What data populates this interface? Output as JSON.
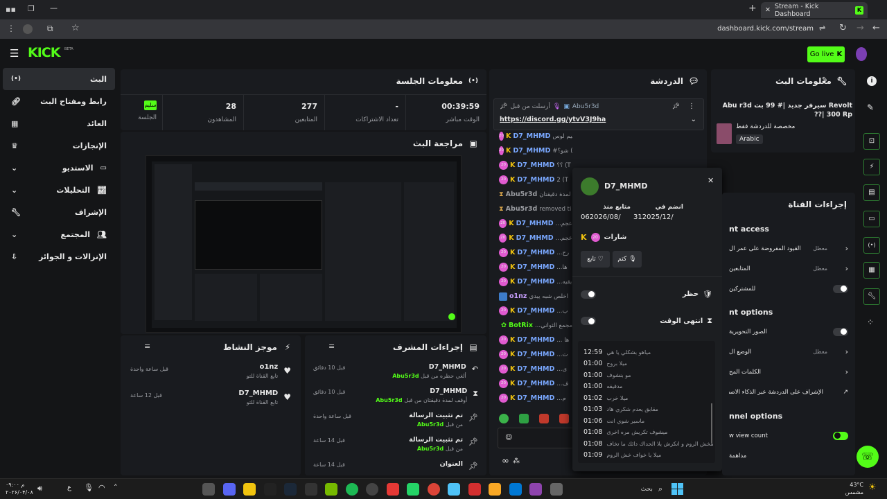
{
  "browser": {
    "tab_title": "Stream - Kick Dashboard",
    "url": "dashboard.kick.com/stream",
    "new_tab": "+"
  },
  "topbar": {
    "logo": "KICK",
    "logo_sup": "BETA",
    "go_live": "Go live"
  },
  "sidebar": {
    "items": [
      {
        "label": "البث",
        "icon": "broadcast-icon"
      },
      {
        "label": "رابط ومفتاح البث",
        "icon": "link-icon"
      },
      {
        "label": "العائد",
        "icon": "chart-icon"
      },
      {
        "label": "الإنجازات",
        "icon": "trophy-icon"
      },
      {
        "label": "الاستديو",
        "icon": "studio-icon"
      },
      {
        "label": "التحليلات",
        "icon": "analytics-icon"
      },
      {
        "label": "الإشراف",
        "icon": "wrench-icon"
      },
      {
        "label": "المجتمع",
        "icon": "community-icon"
      },
      {
        "label": "الإنزالات و الجوائز",
        "icon": "drops-icon"
      }
    ]
  },
  "session": {
    "title": "معلومات الجلسة",
    "status": "سليم",
    "status_label": "الجلسة",
    "stats": [
      {
        "value": "28",
        "label": "المشاهدون"
      },
      {
        "value": "277",
        "label": "المتابعين"
      },
      {
        "value": "-",
        "label": "تعداد الاشتراكات"
      },
      {
        "value": "00:39:59",
        "label": "الوقت مباشر"
      }
    ]
  },
  "preview": {
    "title": "مراجعة البث"
  },
  "activity": {
    "title": "موجز النشاط",
    "items": [
      {
        "user": "o1nz",
        "desc": "تابع القناة للتو",
        "time": "قبل ساعة واحدة"
      },
      {
        "user": "D7_MHMD",
        "desc": "تابع القناة للتو",
        "time": "قبل 12 ساعة"
      }
    ]
  },
  "modactions": {
    "title": "إجراءات المشرف",
    "items": [
      {
        "user": "D7_MHMD",
        "desc": "ألغي حظره من قبل",
        "by": "Abu5r3d",
        "time": "قبل 10 دقائق",
        "icon": "undo-icon"
      },
      {
        "user": "D7_MHMD",
        "desc": "أوقف لمدة دقيقتان من قبل",
        "by": "Abu5r3d",
        "time": "قبل 10 دقائق",
        "icon": "hourglass-icon"
      },
      {
        "user": "تم تثبيت الرسالة",
        "desc": "من قبل",
        "by": "Abu5r3d",
        "time": "قبل ساعة واحدة",
        "icon": "pin-icon"
      },
      {
        "user": "تم تثبيت الرسالة",
        "desc": "من قبل",
        "by": "Abu5r3d",
        "time": "قبل 14 ساعة",
        "icon": "pin-icon"
      },
      {
        "user": "العنوان",
        "desc": "",
        "by": "",
        "time": "قبل 14 ساعة",
        "icon": "pin-icon"
      }
    ]
  },
  "chat": {
    "title": "الدردشة",
    "pinned_by": "أرسلت من قبل",
    "pinned_user": "Abu5r3d",
    "pinned_link": "https://discord.gg/ytvV3J9ha",
    "lines": [
      {
        "user": "D7_MHMD",
        "text": "ياهدولا عليم لوس (Timed out)"
      },
      {
        "user": "D7_MHMD",
        "text": "#شو؟ (Timed out)"
      },
      {
        "user": "D7_MHMD",
        "text": "؟؟ (T"
      },
      {
        "user": "D7_MHMD",
        "text": "2 (T"
      },
      {
        "user": "Abu5r3d",
        "text": "أوقف لمدة دقيقتان D7"
      },
      {
        "user": "Abu5r3d",
        "text": "removed ti"
      },
      {
        "user": "D7_MHMD",
        "text": "...عجم"
      },
      {
        "user": "D7_MHMD",
        "text": "...عجم"
      },
      {
        "user": "D7_MHMD",
        "text": "...رح"
      },
      {
        "user": "D7_MHMD",
        "text": "...ها"
      },
      {
        "user": "D7_MHMD",
        "text": "...يقيه"
      },
      {
        "user": "o1nz",
        "text": "اخلص شبه يبدي"
      },
      {
        "user": "D7_MHMD",
        "text": "...ب"
      },
      {
        "user": "BotRix",
        "text": "...مجمع الثواني"
      },
      {
        "user": "D7_MHMD",
        "text": "... ها"
      },
      {
        "user": "D7_MHMD",
        "text": "...ت"
      },
      {
        "user": "D7_MHMD",
        "text": "...ى"
      },
      {
        "user": "D7_MHMD",
        "text": "...ف"
      },
      {
        "user": "D7_MHMD",
        "text": "...م"
      }
    ]
  },
  "usercard": {
    "name": "D7_MHMD",
    "followed_label": "متابع منذ",
    "followed": "062026/08/",
    "joined_label": "انضم في",
    "joined": "312025/12/",
    "badges_label": "شارات",
    "unfollow": "تابع",
    "mute": "كتم",
    "ban_label": "حظر",
    "timeout_label": "انتهى الوقت",
    "history": [
      {
        "time": "12:59",
        "text": "مياهو بشكلي يا هي"
      },
      {
        "time": "01:00",
        "text": "ميلا بروح"
      },
      {
        "time": "01:00",
        "text": "مو بنشوف"
      },
      {
        "time": "01:00",
        "text": "مدقيقه"
      },
      {
        "time": "01:02",
        "text": "ميلا خرب"
      },
      {
        "time": "01:03",
        "text": "مقابق يعدم شكري هاد"
      },
      {
        "time": "01:06",
        "text": "ماسير شوي انت"
      },
      {
        "time": "01:08",
        "text": "ميشوف تكريش مره اخرى"
      },
      {
        "time": "01:08",
        "text": "مخش الروم و انكرش يلا الحداك دائك ما تخاف"
      },
      {
        "time": "01:09",
        "text": "ميلا يا خواف خش الروم"
      }
    ]
  },
  "streaminfo": {
    "title": "معلومات البث",
    "stream_title": "Revolt سيرفر جديد |# 99 بث Abu r3d ??| 300 Rp",
    "category": "مخصصة للدردشة فقط",
    "language": "Arabic"
  },
  "channelactions": {
    "title": "إجراءات القناة",
    "section1": "nt access",
    "rows1": [
      {
        "label": "القيود المفروضة على عمر ال",
        "value": "معطل",
        "kind": "chev"
      },
      {
        "label": "المتابعين",
        "value": "معطل",
        "kind": "chev"
      },
      {
        "label": "للمشتركين",
        "value": "",
        "kind": "toggle"
      }
    ],
    "section2": "nt options",
    "rows2": [
      {
        "label": "الصور التحويرية",
        "value": "",
        "kind": "toggle"
      },
      {
        "label": "الوضع ال",
        "value": "معطل",
        "kind": "chev"
      },
      {
        "label": "الكلمات المح",
        "value": "",
        "kind": "chev"
      },
      {
        "label": "الإشراف على الدردشة عبر الذكاء الاصط",
        "value": "",
        "kind": "ext"
      }
    ],
    "section3": "nnel options",
    "rows3": [
      {
        "label": "w view count",
        "value": "",
        "kind": "toggle-on"
      },
      {
        "label": "مداهمة",
        "value": "",
        "kind": "none"
      }
    ]
  },
  "taskbar": {
    "time": "۰۹:۰۰ م",
    "date": "۲۰۲۶/۰۴/۰۸",
    "lang": "ع",
    "weather": "43°C",
    "weather_desc": "مشمس",
    "search": "بحث"
  },
  "colors": {
    "accent": "#53fc18",
    "panel": "#191b1f",
    "bg": "#141517",
    "link": "#7aa8ff"
  }
}
